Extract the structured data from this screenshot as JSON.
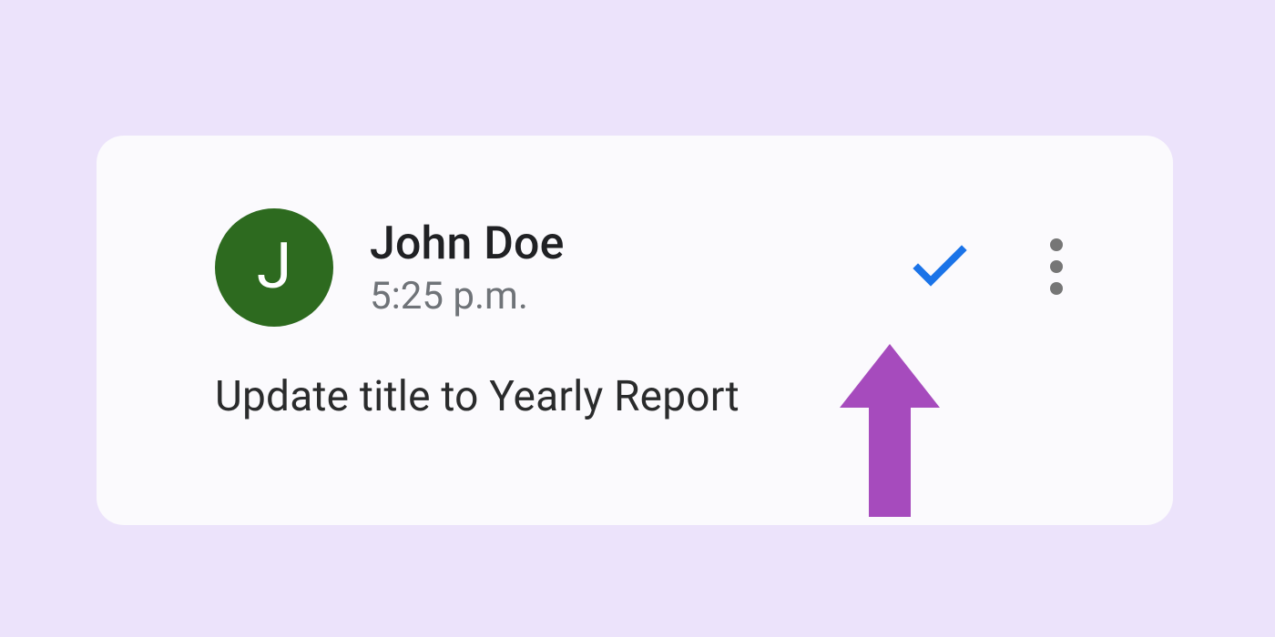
{
  "comment": {
    "avatar_letter": "J",
    "avatar_bg": "#2d6a1f",
    "author": "John Doe",
    "timestamp": "5:25 p.m.",
    "body": "Update title to Yearly Report"
  },
  "colors": {
    "page_bg": "#ece3fb",
    "card_bg": "#fbfafd",
    "check": "#1a73e8",
    "more_dots": "#767676",
    "arrow": "#a64bbd"
  }
}
